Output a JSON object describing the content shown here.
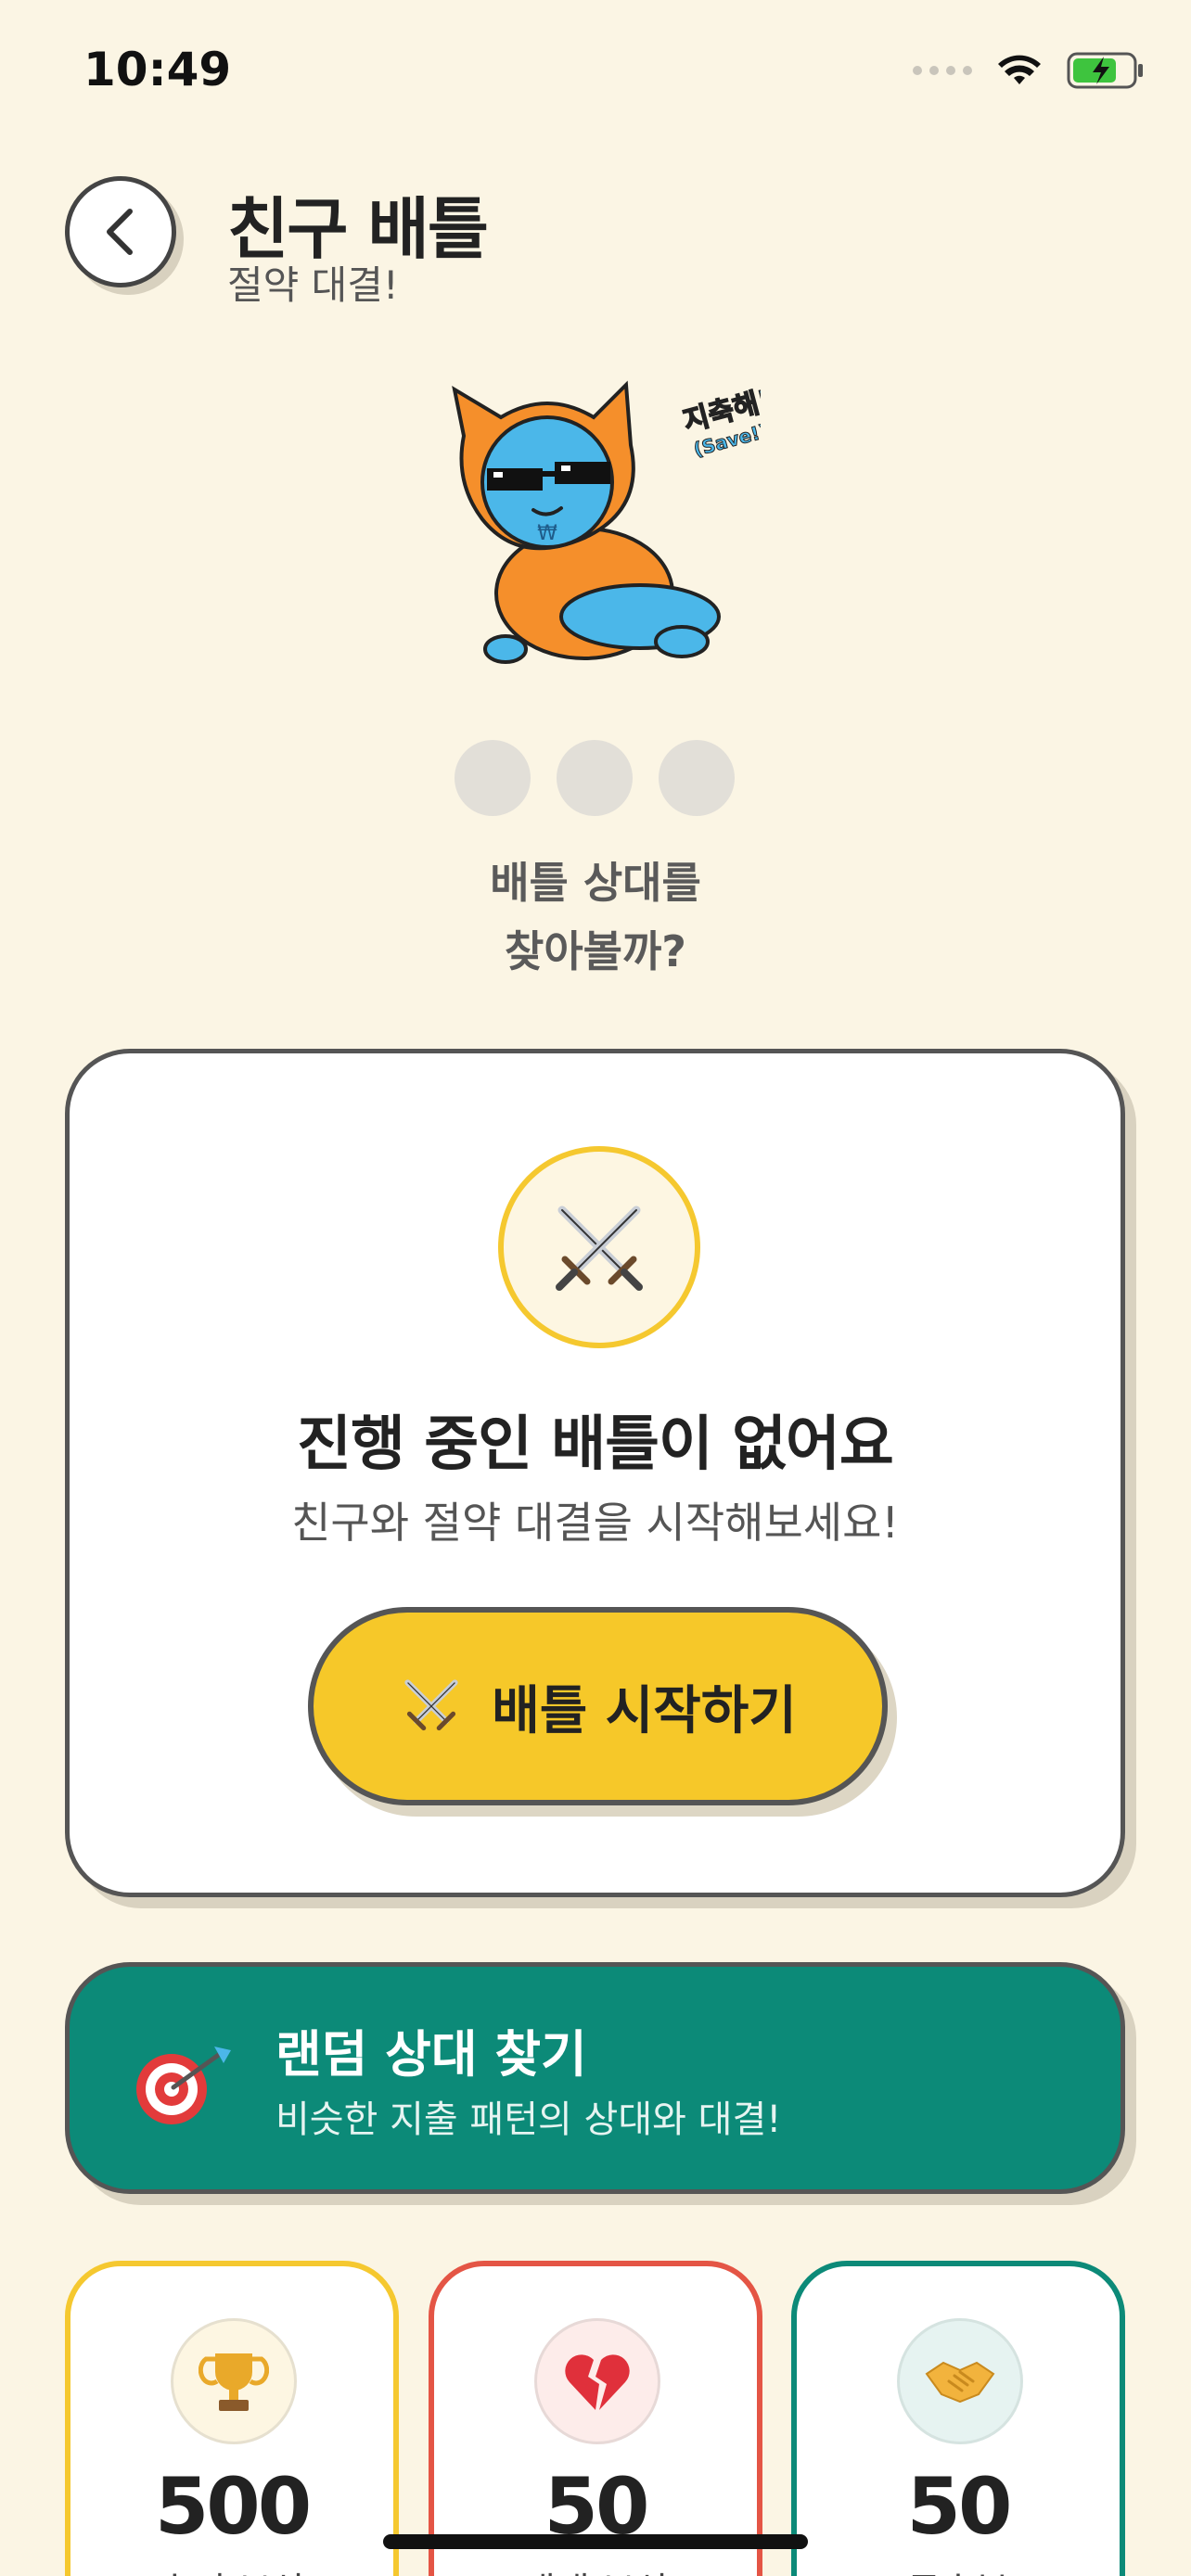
{
  "status_bar": {
    "time": "10:49",
    "icons": [
      "signal-dots",
      "wifi-icon",
      "battery-charging-icon"
    ]
  },
  "header": {
    "back_icon": "chevron-left-icon",
    "title": "친구 배틀",
    "subtitle": "절약 대결!"
  },
  "mascot": {
    "icon": "cat-mascot-with-sunglasses",
    "speech": "지축해!",
    "speech_sub": "(Save!)"
  },
  "prompt": {
    "line1": "배틀 상대를",
    "line2": "찾아볼까?"
  },
  "empty_state": {
    "icon": "crossed-swords-icon",
    "title": "진행 중인 배틀이 없어요",
    "description": "친구와 절약 대결을 시작해보세요!",
    "button_label": "배틀 시작하기"
  },
  "random_match": {
    "icon": "target-dart-icon",
    "title": "랜덤 상대 찾기",
    "description": "비슷한 지출 패턴의 상대와 대결!"
  },
  "rewards": [
    {
      "icon": "trophy-icon",
      "value": "500",
      "label": "승리 보상",
      "color": "#F5C82F"
    },
    {
      "icon": "broken-heart-icon",
      "value": "50",
      "label": "패배 보상",
      "color": "#E45545"
    },
    {
      "icon": "handshake-icon",
      "value": "50",
      "label": "무승부",
      "color": "#0C8A78"
    }
  ],
  "colors": {
    "background": "#FBF5E4",
    "accent_yellow": "#F6C829",
    "accent_green": "#0C8A78",
    "accent_red": "#E45545"
  }
}
